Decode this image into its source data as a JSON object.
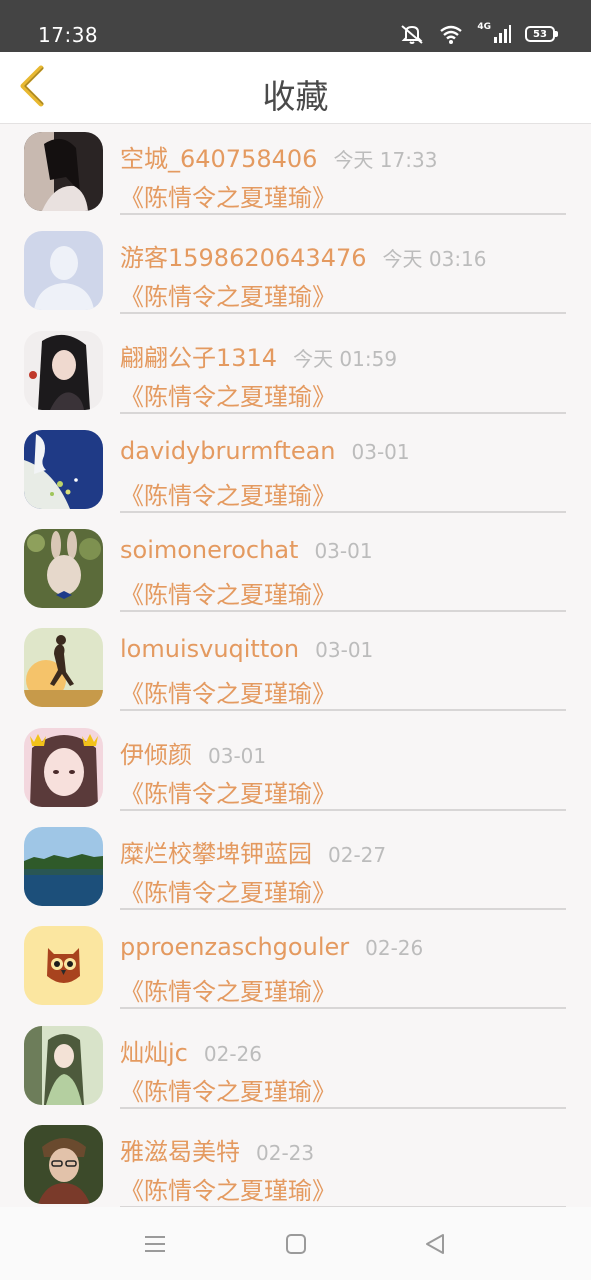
{
  "status_bar": {
    "time": "17:38",
    "network": "4G",
    "battery": "53"
  },
  "header": {
    "title": "收藏",
    "back_icon": "chevron-left-icon",
    "accent_color": "#e8b830"
  },
  "favorites": [
    {
      "username": "空城_640758406",
      "time": "今天 17:33",
      "book": "《陈情令之夏瑾瑜》",
      "avatar": "avatar-photo-woman"
    },
    {
      "username": "游客1598620643476",
      "time": "今天 03:16",
      "book": "《陈情令之夏瑾瑜》",
      "avatar": "avatar-default-silhouette"
    },
    {
      "username": "翩翩公子1314",
      "time": "今天 01:59",
      "book": "《陈情令之夏瑾瑜》",
      "avatar": "avatar-illustration-man"
    },
    {
      "username": "davidybrurmftean",
      "time": "03-01",
      "book": "《陈情令之夏瑾瑜》",
      "avatar": "avatar-blue-art"
    },
    {
      "username": "soimonerochat",
      "time": "03-01",
      "book": "《陈情令之夏瑾瑜》",
      "avatar": "avatar-rabbit"
    },
    {
      "username": "lomuisvuqitton",
      "time": "03-01",
      "book": "《陈情令之夏瑾瑜》",
      "avatar": "avatar-runner-sunset"
    },
    {
      "username": "伊倾颜",
      "time": "03-01",
      "book": "《陈情令之夏瑾瑜》",
      "avatar": "avatar-girl-crown"
    },
    {
      "username": "糜烂校攀埤钾蓝园",
      "time": "02-27",
      "book": "《陈情令之夏瑾瑜》",
      "avatar": "avatar-lake-landscape"
    },
    {
      "username": "pproenzaschgouler",
      "time": "02-26",
      "book": "《陈情令之夏瑾瑜》",
      "avatar": "avatar-owl"
    },
    {
      "username": "灿灿jc",
      "time": "02-26",
      "book": "《陈情令之夏瑾瑜》",
      "avatar": "avatar-illustration-lady"
    },
    {
      "username": "雅滋曷美特",
      "time": "02-23",
      "book": "《陈情令之夏瑾瑜》",
      "avatar": "avatar-photo-boy"
    }
  ],
  "colors": {
    "username": "#e49a60",
    "timestamp": "#bcbcbc",
    "divider": "#d8d6d6"
  },
  "nav_bar": {
    "menu_icon": "menu-icon",
    "home_icon": "home-square-icon",
    "back_icon": "back-triangle-icon"
  }
}
